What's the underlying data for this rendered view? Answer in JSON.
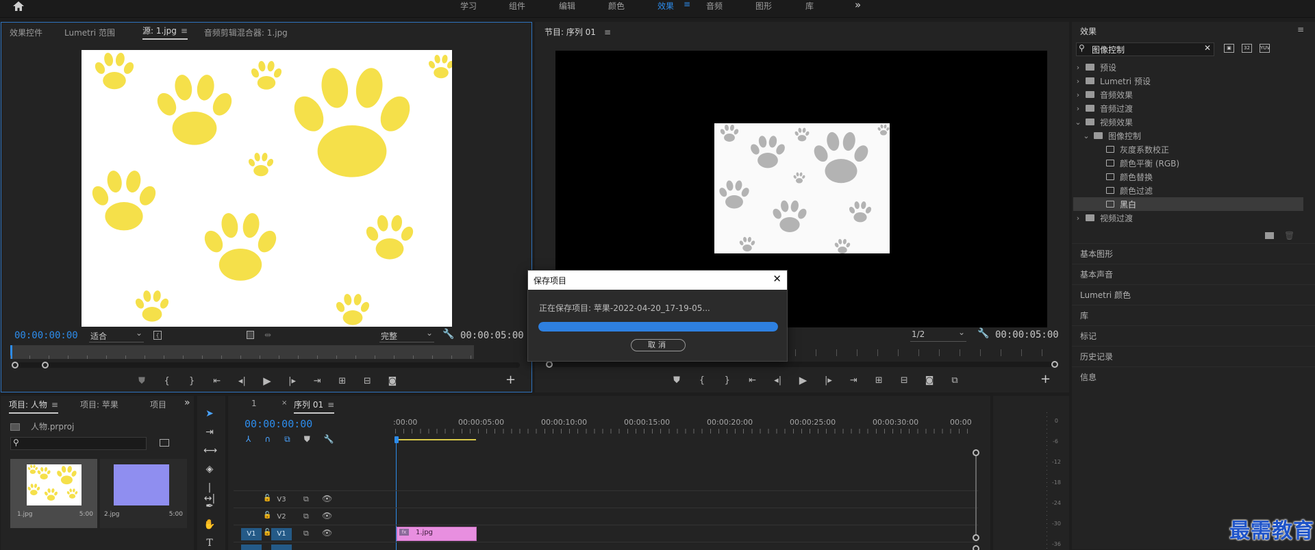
{
  "menubar": {
    "items": [
      "学习",
      "组件",
      "编辑",
      "颜色",
      "效果",
      "音频",
      "图形",
      "库"
    ],
    "active": "效果",
    "more": "»"
  },
  "source_monitor": {
    "tabs": [
      "效果控件",
      "Lumetri 范围",
      "源: 1.jpg",
      "音频剪辑混合器: 1.jpg"
    ],
    "active_tab": "源: 1.jpg",
    "timecode": "00:00:00:00",
    "fit": "适合",
    "quality": "完整",
    "duration": "00:00:05:00"
  },
  "program_monitor": {
    "title": "节目: 序列 01",
    "resolution": "1/2",
    "duration": "00:00:05:00"
  },
  "save_dialog": {
    "title": "保存项目",
    "message": "正在保存项目: 苹果-2022-04-20_17-19-05...",
    "progress": 1.0,
    "cancel": "取消"
  },
  "effects_panel": {
    "title": "效果",
    "search_value": "图像控制",
    "tree": [
      {
        "label": "预设",
        "level": 0,
        "kind": "folder",
        "open": false
      },
      {
        "label": "Lumetri 预设",
        "level": 0,
        "kind": "folder",
        "open": false
      },
      {
        "label": "音频效果",
        "level": 0,
        "kind": "folder",
        "open": false
      },
      {
        "label": "音频过渡",
        "level": 0,
        "kind": "folder",
        "open": false
      },
      {
        "label": "视频效果",
        "level": 0,
        "kind": "folder",
        "open": true
      },
      {
        "label": "图像控制",
        "level": 1,
        "kind": "folder",
        "open": true
      },
      {
        "label": "灰度系数校正",
        "level": 2,
        "kind": "effect"
      },
      {
        "label": "颜色平衡 (RGB)",
        "level": 2,
        "kind": "effect"
      },
      {
        "label": "颜色替换",
        "level": 2,
        "kind": "effect"
      },
      {
        "label": "颜色过滤",
        "level": 2,
        "kind": "effect"
      },
      {
        "label": "黑白",
        "level": 2,
        "kind": "effect",
        "selected": true
      },
      {
        "label": "视频过渡",
        "level": 0,
        "kind": "folder",
        "open": false
      }
    ]
  },
  "side_panels": [
    "基本图形",
    "基本声音",
    "Lumetri 颜色",
    "库",
    "标记",
    "历史记录",
    "信息"
  ],
  "project_panel": {
    "tabs": [
      "项目: 人物",
      "项目: 苹果",
      "项目"
    ],
    "active_tab": "项目: 人物",
    "file": "人物.prproj",
    "items": [
      {
        "name": "1.jpg",
        "duration": "5:00"
      },
      {
        "name": "2.jpg",
        "duration": "5:00"
      }
    ]
  },
  "timeline": {
    "tabs": [
      "1",
      "序列 01"
    ],
    "active_tab": "序列 01",
    "timecode": "00:00:00:00",
    "ruler": [
      ":00:00",
      "00:00:05:00",
      "00:00:10:00",
      "00:00:15:00",
      "00:00:20:00",
      "00:00:25:00",
      "00:00:30:00",
      "00:00"
    ],
    "tracks": [
      {
        "name": "V3",
        "src": ""
      },
      {
        "name": "V2",
        "src": ""
      },
      {
        "name": "V1",
        "src": "V1"
      }
    ],
    "clip": "1.jpg"
  },
  "audio_meter": {
    "labels": [
      "0",
      "-6",
      "-12",
      "-18",
      "-24",
      "-30",
      "-36"
    ]
  },
  "watermark": "最需教育",
  "colors": {
    "accent": "#2d8ceb",
    "paw_yellow": "#f5e04a",
    "paw_gray": "#b3b3b3",
    "clip_pink": "#e88fe0",
    "thumb_purple": "#8f8ef0"
  }
}
